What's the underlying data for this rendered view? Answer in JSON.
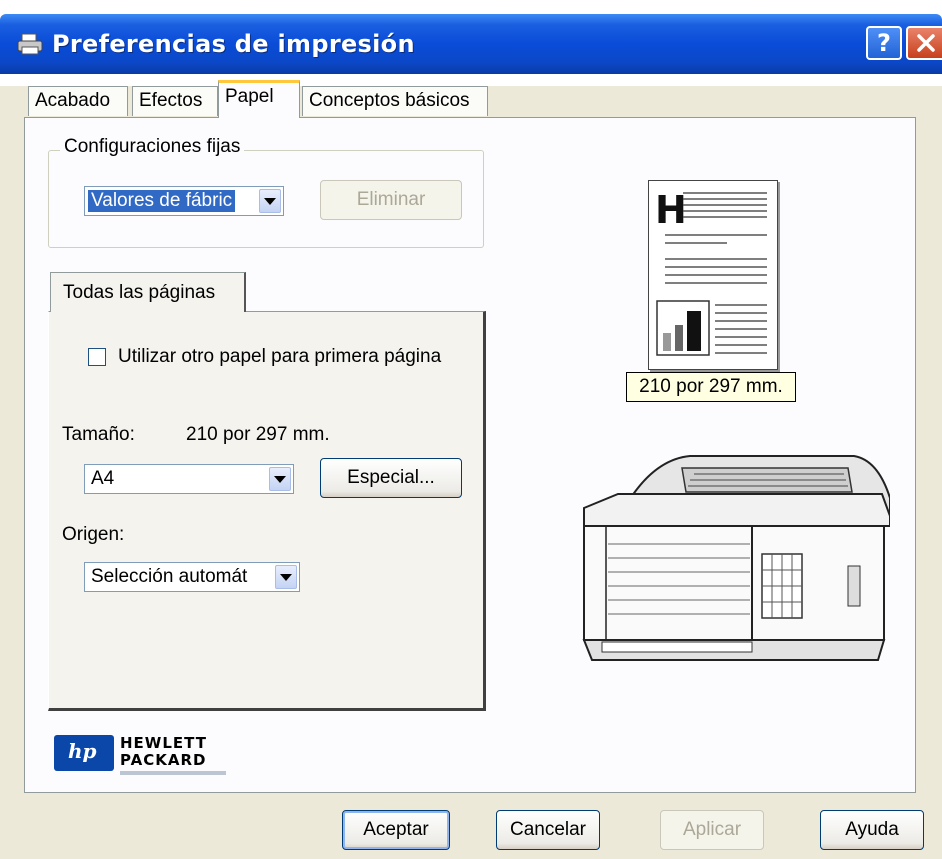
{
  "window": {
    "title": "Preferencias de impresión"
  },
  "tabs": [
    {
      "label": "Acabado"
    },
    {
      "label": "Efectos"
    },
    {
      "label": "Papel"
    },
    {
      "label": "Conceptos básicos"
    }
  ],
  "presets": {
    "legend": "Configuraciones fijas",
    "selected": "Valores de fábric",
    "delete_label": "Eliminar"
  },
  "inner_tab": {
    "label": "Todas las páginas"
  },
  "first_page": {
    "label": "Utilizar otro papel para primera página",
    "checked": false
  },
  "size": {
    "label": "Tamaño:",
    "value_text": "210 por 297 mm.",
    "selected": "A4",
    "custom_label": "Especial..."
  },
  "source": {
    "label": "Origen:",
    "selected": "Selección automát"
  },
  "brand": {
    "line1": "HEWLETT",
    "line2": "PACKARD",
    "badge": "hp"
  },
  "preview": {
    "size_label": "210 por 297 mm.",
    "letter": "H"
  },
  "buttons": {
    "ok": "Aceptar",
    "cancel": "Cancelar",
    "apply": "Aplicar",
    "help": "Ayuda"
  },
  "colors": {
    "titlebar": "#0a4cd8",
    "selection": "#316ac5",
    "active_tab_accent": "#ffc83c"
  }
}
